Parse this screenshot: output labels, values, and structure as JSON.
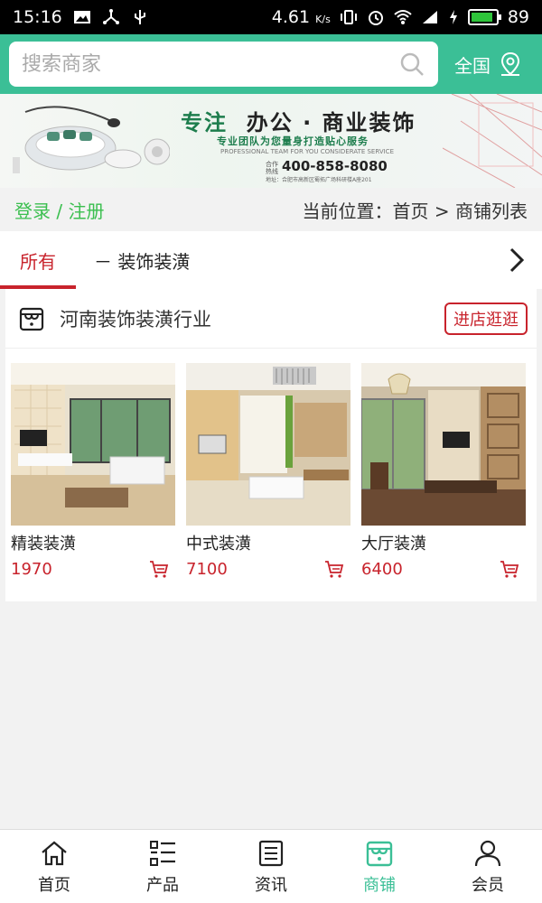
{
  "status_bar": {
    "time": "15:16",
    "speed": "4.61",
    "speed_unit": "K/s",
    "battery_level": "89",
    "battery_percent_fill": 0.89,
    "icons": [
      "image-icon",
      "share-icon",
      "usb-icon",
      "vibrate-icon",
      "alarm-icon",
      "wifi-icon",
      "signal-4g-icon",
      "charging-icon",
      "battery-icon"
    ]
  },
  "header": {
    "search_placeholder": "搜索商家",
    "region_label": "全国",
    "accent_color": "#3bbf96"
  },
  "banner": {
    "title_1": "专注",
    "title_2": "办公 · 商业装饰",
    "subtitle": "专业团队为您量身打造贴心服务",
    "subtitle_en": "PROFESSIONAL TEAM FOR YOU CONSIDERATE SERVICE",
    "phone_label": "合作热线",
    "phone": "400-858-8080",
    "address": "地址：合肥市高新区蜀拓广场科研楼A座201"
  },
  "location": {
    "login_register": "登录 / 注册",
    "breadcrumb": "当前位置：首页 > 商铺列表"
  },
  "tabs": {
    "all_label": "所有",
    "category_label": "－ 装饰装潢"
  },
  "shop": {
    "name": "河南装饰装潢行业",
    "visit_label": "进店逛逛",
    "products": [
      {
        "name": "精装装潢",
        "price": "1970"
      },
      {
        "name": "中式装潢",
        "price": "7100"
      },
      {
        "name": "大厅装潢",
        "price": "6400"
      }
    ]
  },
  "bottom_nav": {
    "items": [
      {
        "label": "首页",
        "icon": "home-icon"
      },
      {
        "label": "产品",
        "icon": "list-icon"
      },
      {
        "label": "资讯",
        "icon": "news-icon"
      },
      {
        "label": "商铺",
        "icon": "shop-icon"
      },
      {
        "label": "会员",
        "icon": "user-icon"
      }
    ],
    "active_index": 3
  }
}
